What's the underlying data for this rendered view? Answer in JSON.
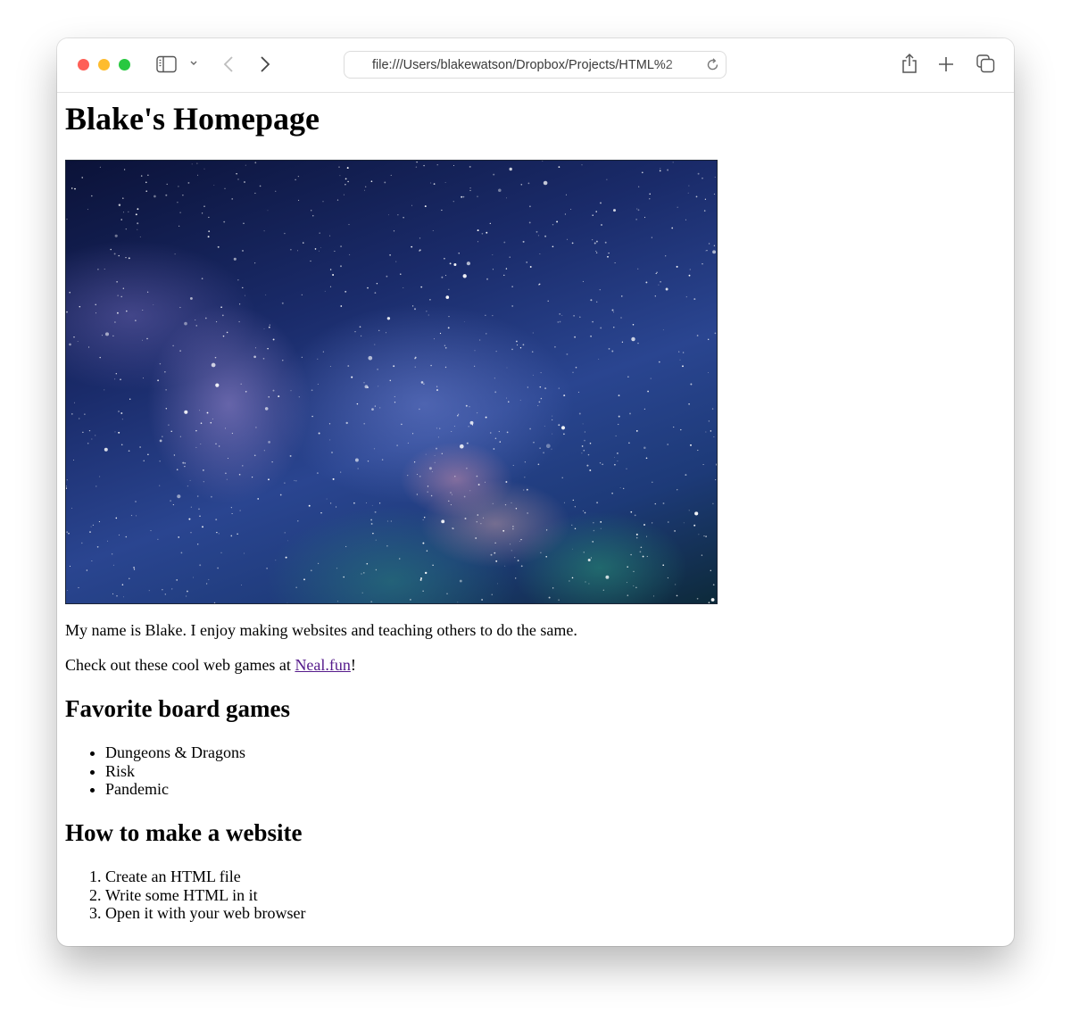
{
  "browser": {
    "url": "file:///Users/blakewatson/Dropbox/Projects/HTML%2",
    "icons": {
      "close": "close-window-icon",
      "minimize": "minimize-window-icon",
      "maximize": "maximize-window-icon",
      "sidebar": "sidebar-icon",
      "sidebar_menu": "chevron-down-icon",
      "back": "chevron-left-icon",
      "forward": "chevron-right-icon",
      "reload": "reload-icon",
      "share": "share-icon",
      "new_tab": "plus-icon",
      "tabs": "tab-overview-icon"
    },
    "colors": {
      "close": "#fe5f57",
      "minimize": "#febc2e",
      "maximize": "#28c840"
    }
  },
  "page": {
    "title": "Blake's Homepage",
    "hero_image": {
      "alt": "Milky Way starry night sky"
    },
    "intro": "My name is Blake. I enjoy making websites and teaching others to do the same.",
    "games_prefix": "Check out these cool web games at ",
    "games_link": "Neal.fun",
    "games_suffix": "!",
    "link_color": "#551a8b",
    "board_games": {
      "heading": "Favorite board games",
      "items": [
        "Dungeons & Dragons",
        "Risk",
        "Pandemic"
      ]
    },
    "how_to": {
      "heading": "How to make a website",
      "steps": [
        "Create an HTML file",
        "Write some HTML in it",
        "Open it with your web browser"
      ]
    }
  }
}
